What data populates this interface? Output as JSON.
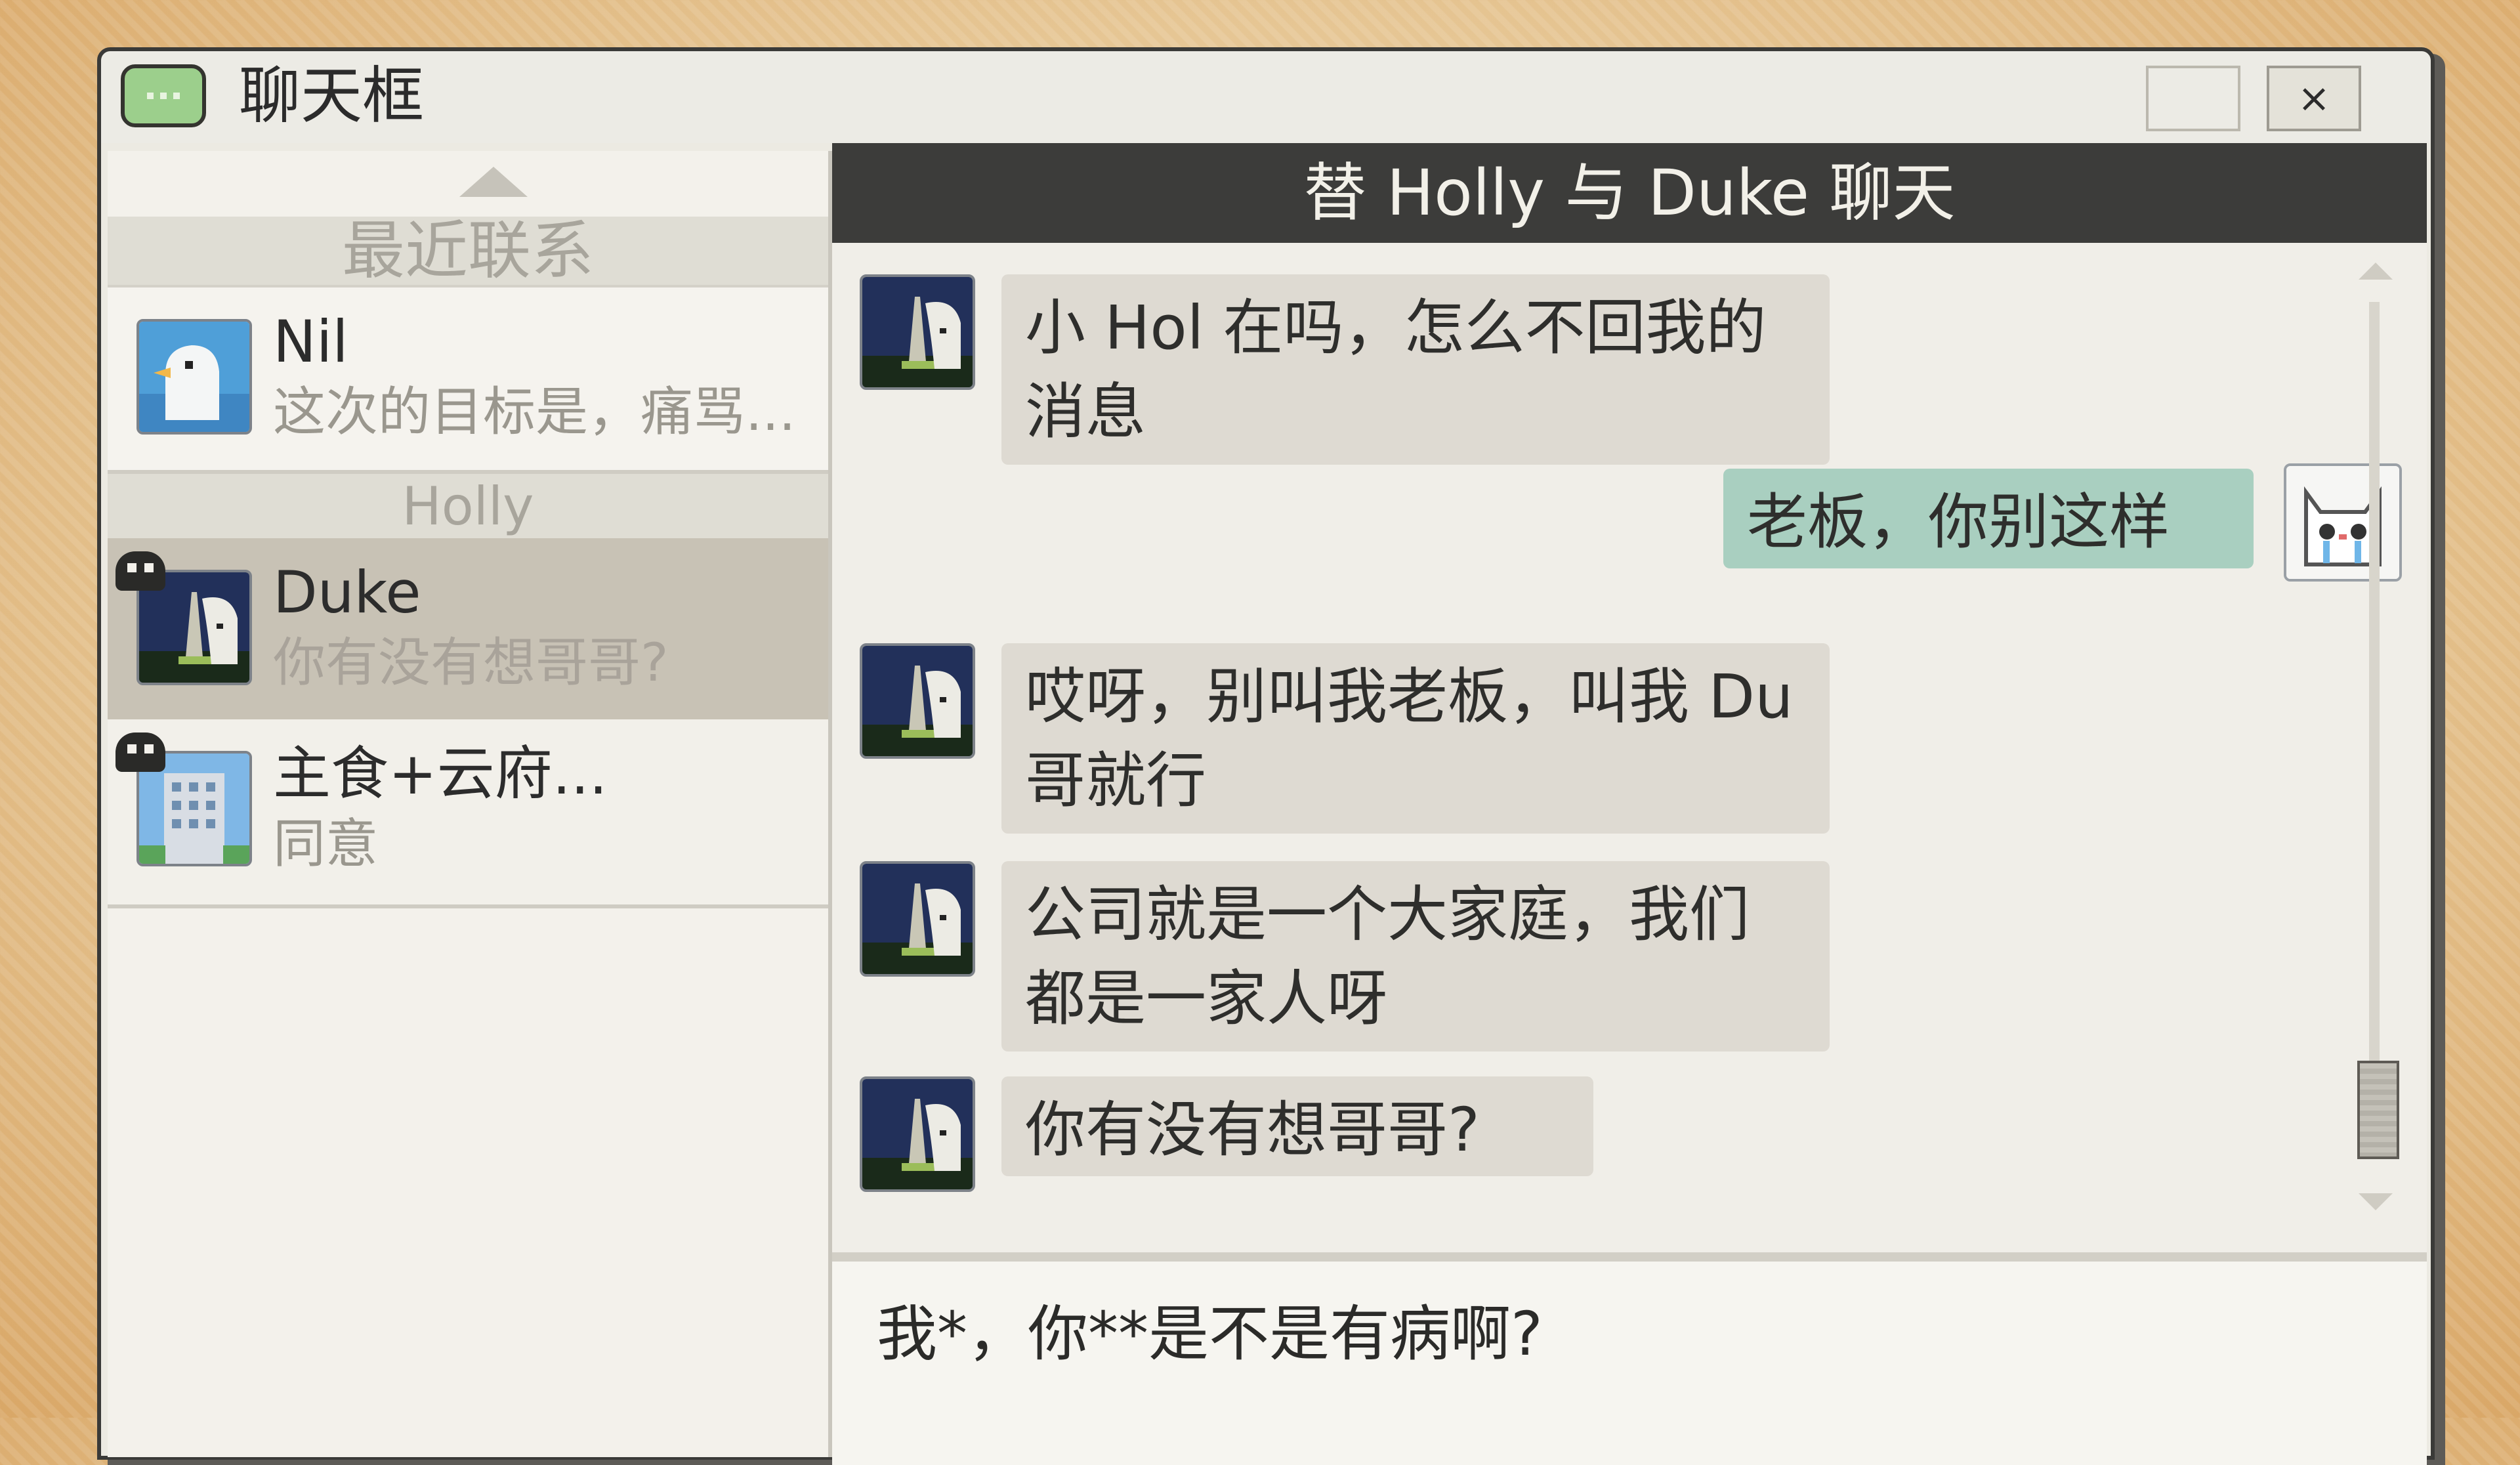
{
  "window": {
    "title": "聊天框",
    "app_icon": "chat-bubble-icon",
    "close_glyph": "×"
  },
  "sidebar": {
    "sections": {
      "recent": "最近联系",
      "holly": "Holly"
    },
    "contacts": [
      {
        "name": "Nil",
        "preview": "这次的目标是，痛骂...",
        "avatar": "seagull-avatar"
      },
      {
        "name": "Duke",
        "preview": "你有没有想哥哥?",
        "avatar": "tower-night-avatar",
        "selected": true,
        "badge": "mask-icon"
      },
      {
        "name": "主食+云府...",
        "preview": "同意",
        "avatar": "building-avatar",
        "badge": "mask-icon"
      }
    ]
  },
  "chat": {
    "header": "替 Holly 与 Duke 聊天",
    "messages": [
      {
        "from": "Duke",
        "text": "小 Hol 在吗，怎么不回我的消息"
      },
      {
        "from": "Holly",
        "text": "老板，你别这样"
      },
      {
        "from": "Duke",
        "text": "哎呀，别叫我老板，叫我 Du 哥就行"
      },
      {
        "from": "Duke",
        "text": "公司就是一个大家庭，我们都是一家人呀"
      },
      {
        "from": "Duke",
        "text": "你有没有想哥哥?"
      }
    ],
    "input_value": "我*，你**是不是有病啊?"
  },
  "colors": {
    "header_bg": "#3c3c3a",
    "incoming_bubble": "#dedad2",
    "outgoing_bubble": "#a9cfc0",
    "selected_row": "#c8c2b5"
  }
}
